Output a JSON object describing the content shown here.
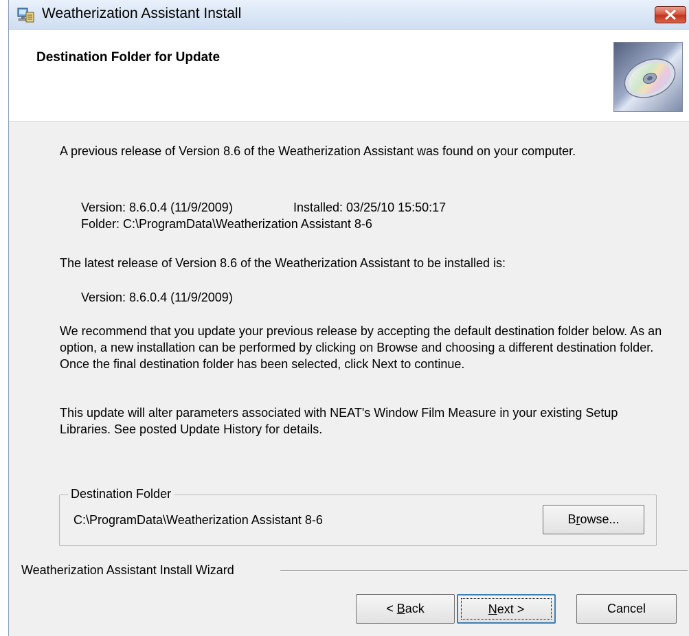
{
  "window": {
    "title": "Weatherization Assistant Install"
  },
  "header": {
    "title": "Destination Folder for Update",
    "image": "cd-disc-icon"
  },
  "content": {
    "intro": "A previous release of Version 8.6 of the Weatherization Assistant was found on your computer.",
    "previous_version": "Version: 8.6.0.4 (11/9/2009)",
    "installed": "Installed: 03/25/10 15:50:17",
    "previous_folder": "Folder: C:\\ProgramData\\Weatherization Assistant 8-6",
    "latest_intro": "The latest release of Version 8.6 of the Weatherization Assistant to be installed is:",
    "latest_version": "Version: 8.6.0.4 (11/9/2009)",
    "recommend": "We recommend that you update your previous release by accepting the default destination folder below.  As an option, a new installation can be performed by clicking on Browse and choosing a different destination folder.  Once the final destination folder has been selected, click Next to continue.",
    "update_note": "This update will alter parameters associated with NEAT's Window Film Measure in your existing Setup Libraries.  See posted Update History for details."
  },
  "destination": {
    "legend": "Destination Folder",
    "path": "C:\\ProgramData\\Weatherization Assistant 8-6",
    "browse_pre": "B",
    "browse_key": "r",
    "browse_post": "owse..."
  },
  "footer": {
    "wizard_label": "Weatherization Assistant Install Wizard",
    "back_pre": "< ",
    "back_key": "B",
    "back_post": "ack",
    "next_key": "N",
    "next_post": "ext >",
    "cancel": "Cancel"
  },
  "colors": {
    "close_button": "#c7402a",
    "focus_border": "#3c7fb1",
    "dialog_bg": "#f0f0f0"
  }
}
